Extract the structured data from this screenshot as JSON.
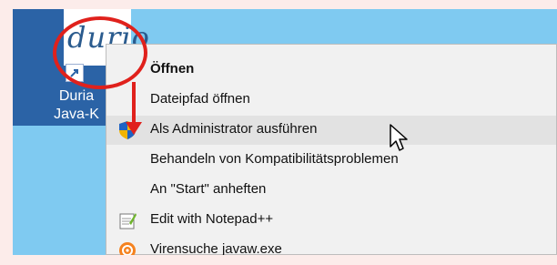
{
  "desktop_icon": {
    "logo_text": "durio",
    "label_line1": "Duria",
    "label_line2": "Java-K"
  },
  "context_menu": {
    "items": [
      {
        "label": "Öffnen",
        "icon": null,
        "bold": true
      },
      {
        "label": "Dateipfad öffnen",
        "icon": null
      },
      {
        "label": "Als Administrator ausführen",
        "icon": "uac-shield-icon",
        "highlighted": true
      },
      {
        "label": "Behandeln von Kompatibilitätsproblemen",
        "icon": null
      },
      {
        "label": "An \"Start\" anheften",
        "icon": null
      },
      {
        "label": "Edit with Notepad++",
        "icon": "notepad-plus-plus-icon"
      },
      {
        "label": "Virensuche javaw.exe",
        "icon": "antivirus-icon"
      }
    ]
  },
  "colors": {
    "annotation": "#e0211c",
    "desktop": "#7fcaf1",
    "icon_selection": "#2b63a6",
    "menu_background": "#f1f1f1",
    "menu_highlight": "#e2e2e2",
    "page_background": "#fcecea"
  }
}
